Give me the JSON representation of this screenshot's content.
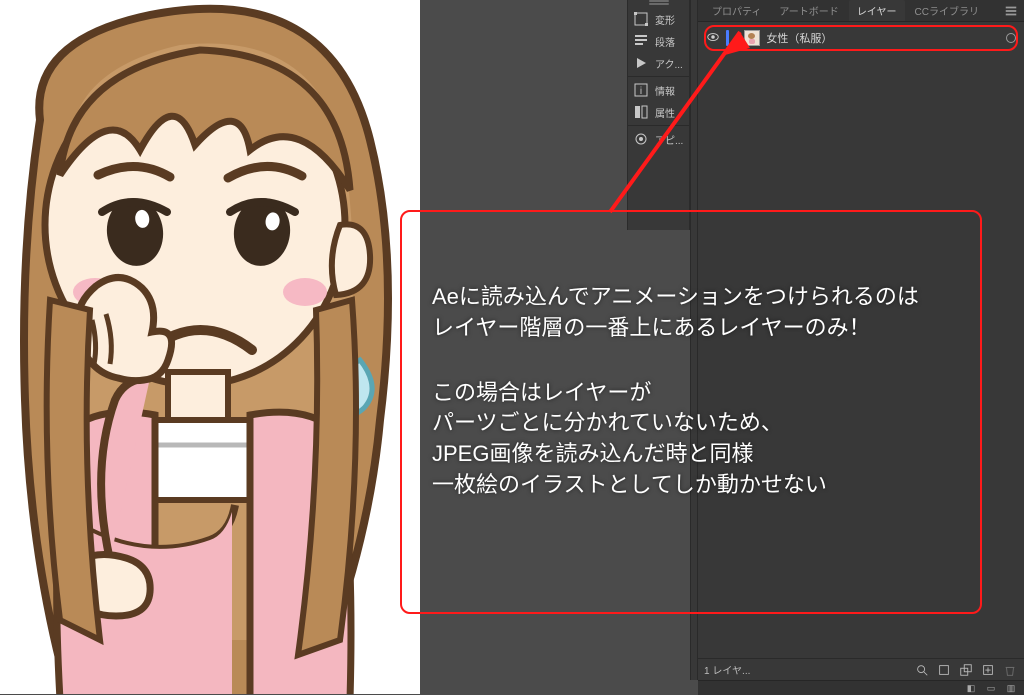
{
  "icon_strip": {
    "items": [
      {
        "id": "transform",
        "label": "変形"
      },
      {
        "id": "paragraph",
        "label": "段落"
      },
      {
        "id": "actions",
        "label": "アク..."
      },
      {
        "id": "info",
        "label": "情報"
      },
      {
        "id": "attributes",
        "label": "属性"
      },
      {
        "id": "appearance",
        "label": "アピ..."
      }
    ]
  },
  "tabs": {
    "t0": "プロパティ",
    "t1": "アートボード",
    "t2": "レイヤー",
    "t3": "CCライブラリ"
  },
  "layer": {
    "name": "女性（私服）",
    "expand_glyph": "›"
  },
  "footer": {
    "count": "1 レイヤ..."
  },
  "callout": {
    "line1": "Aeに読み込んでアニメーションをつけられるのは\nレイヤー階層の一番上にあるレイヤーのみ！",
    "line2": "この場合はレイヤーが\nパーツごとに分かれていないため、\nJPEG画像を読み込んだ時と同様\n一枚絵のイラストとしてしか動かせない"
  }
}
